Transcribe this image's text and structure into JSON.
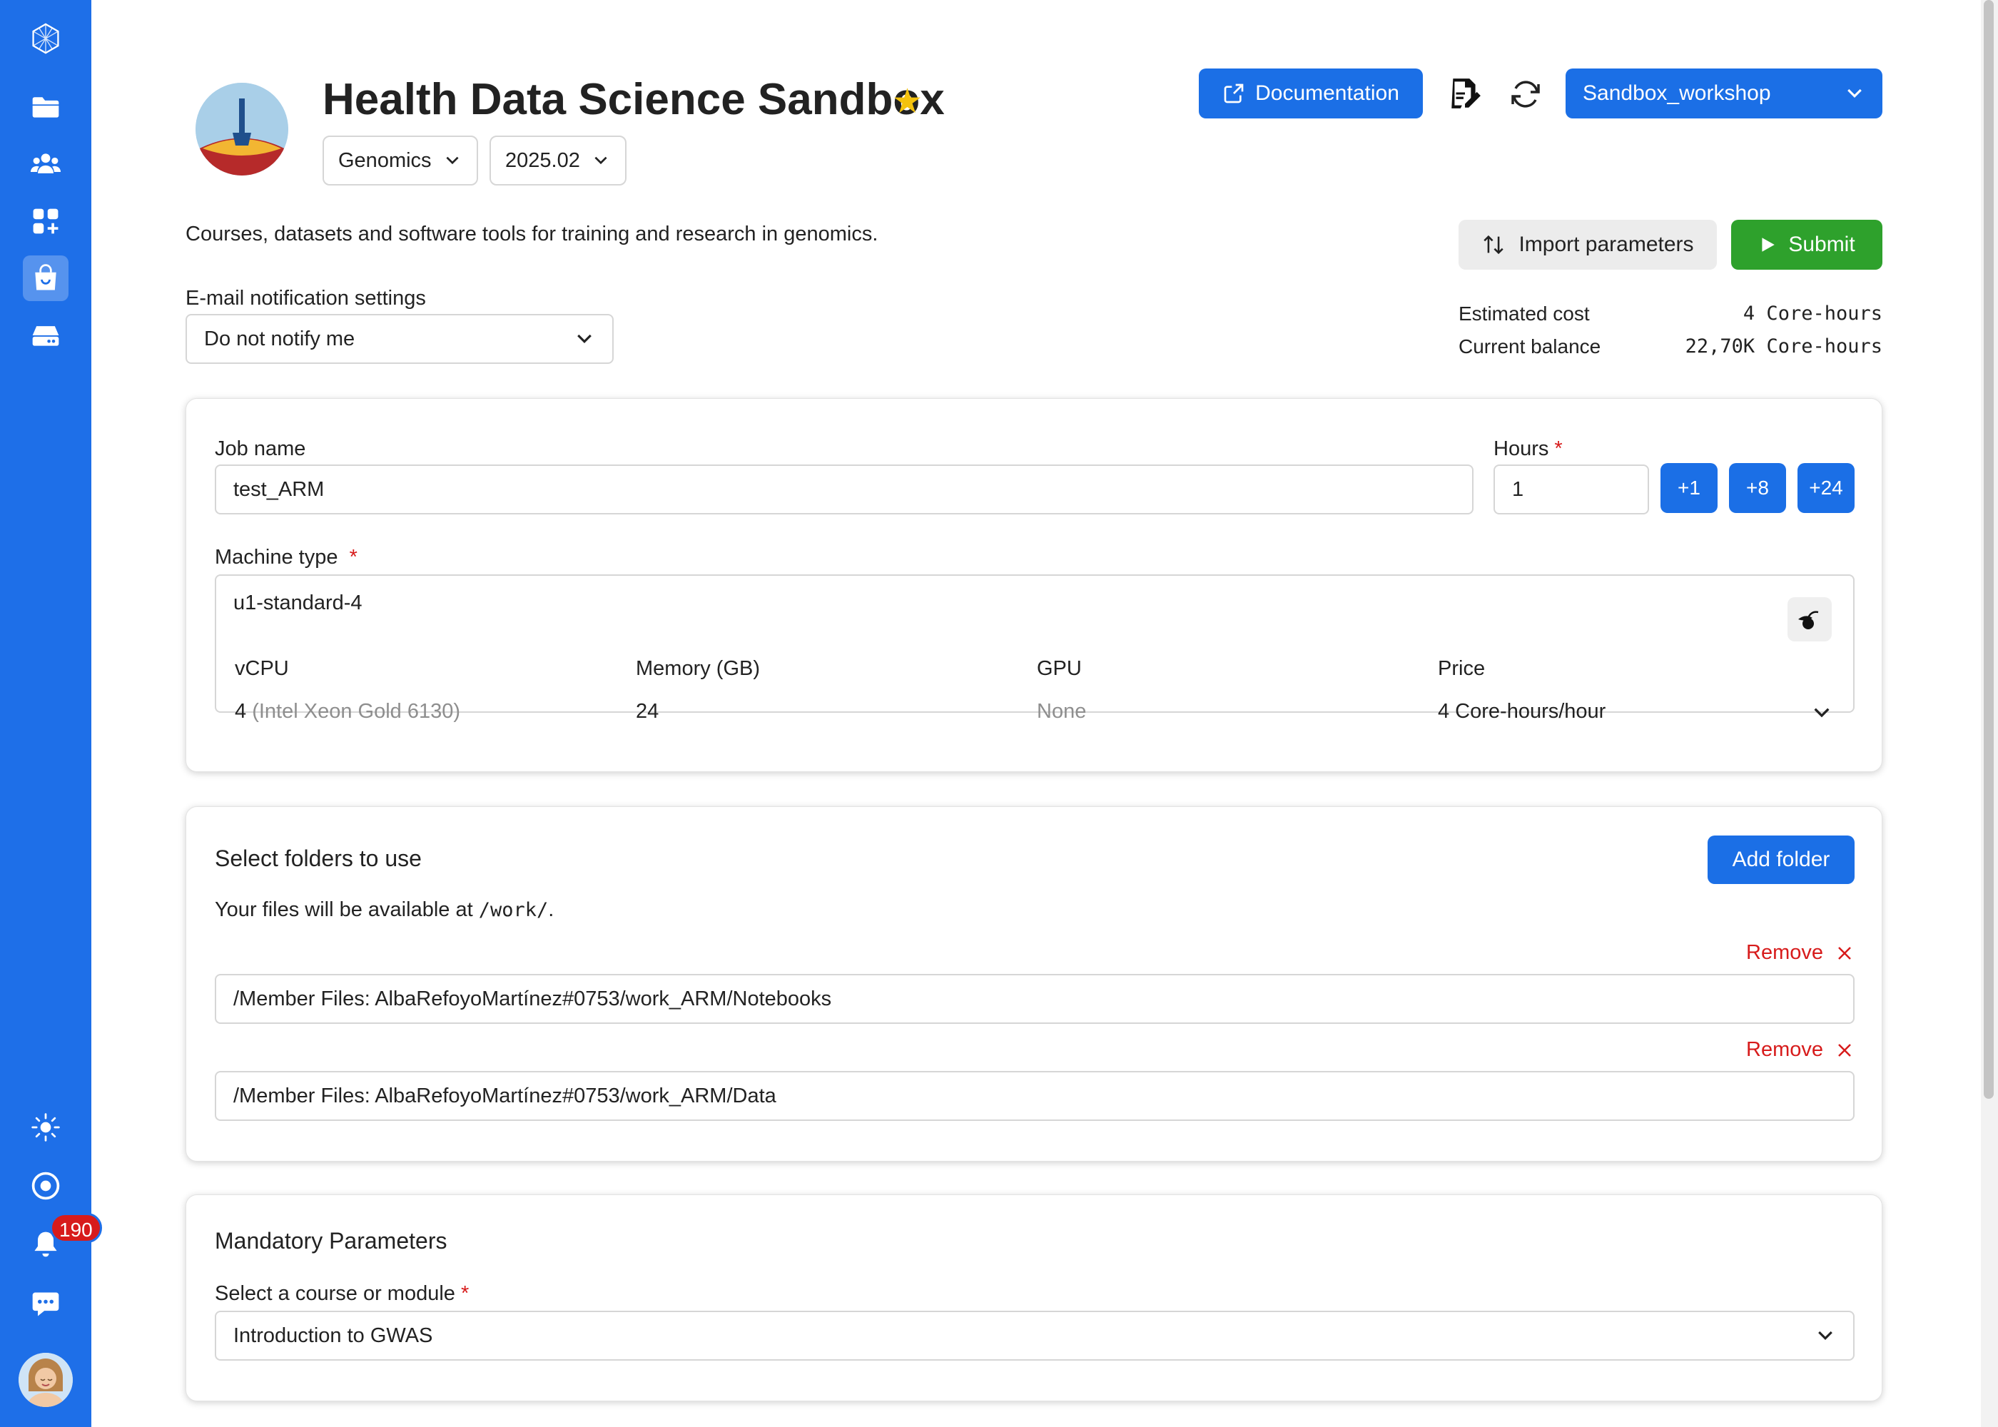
{
  "app": {
    "title": "Health Data Science Sandbox",
    "category": "Genomics",
    "version": "2025.02",
    "description": "Courses, datasets and software tools for training and research in genomics."
  },
  "header": {
    "documentation_label": "Documentation",
    "workspace": "Sandbox_workshop",
    "import_label": "Import parameters",
    "submit_label": "Submit"
  },
  "email": {
    "label": "E-mail notification settings",
    "value": "Do not notify me"
  },
  "cost": {
    "estimated_label": "Estimated cost",
    "estimated_value": "4 Core-hours",
    "balance_label": "Current balance",
    "balance_value": "22,70K Core-hours"
  },
  "job": {
    "name_label": "Job name",
    "name_value": "test_ARM",
    "hours_label": "Hours",
    "hours_value": "1",
    "hour_buttons": [
      "+1",
      "+8",
      "+24"
    ],
    "machine_label": "Machine type",
    "machine_value": "u1-standard-4",
    "spec_headers": [
      "vCPU",
      "Memory (GB)",
      "GPU",
      "Price"
    ],
    "vcpu_count": "4",
    "vcpu_model": "(Intel Xeon Gold 6130)",
    "memory": "24",
    "gpu": "None",
    "price": "4 Core-hours/hour"
  },
  "folders": {
    "title": "Select folders to use",
    "add_label": "Add folder",
    "note_prefix": "Your files will be available at ",
    "note_path": "/work/",
    "note_suffix": ".",
    "remove_label": "Remove",
    "items": [
      "/Member Files: AlbaRefoyoMartínez#0753/work_ARM/Notebooks",
      "/Member Files: AlbaRefoyoMartínez#0753/work_ARM/Data"
    ]
  },
  "mandatory": {
    "title": "Mandatory Parameters",
    "course_label": "Select a course or module",
    "course_value": "Introduction to GWAS"
  },
  "sidebar": {
    "notification_count": "190",
    "icons": [
      "app-logo-icon",
      "files-icon",
      "projects-icon",
      "applications-icon",
      "app-store-icon",
      "resources-icon",
      "theme-icon",
      "status-icon",
      "notifications-icon",
      "support-icon"
    ]
  },
  "colors": {
    "primary": "#1b6fe6",
    "sidebar": "#1e6fe8",
    "success": "#2ea12c",
    "danger": "#d71b1b",
    "star": "#f4c20d"
  }
}
